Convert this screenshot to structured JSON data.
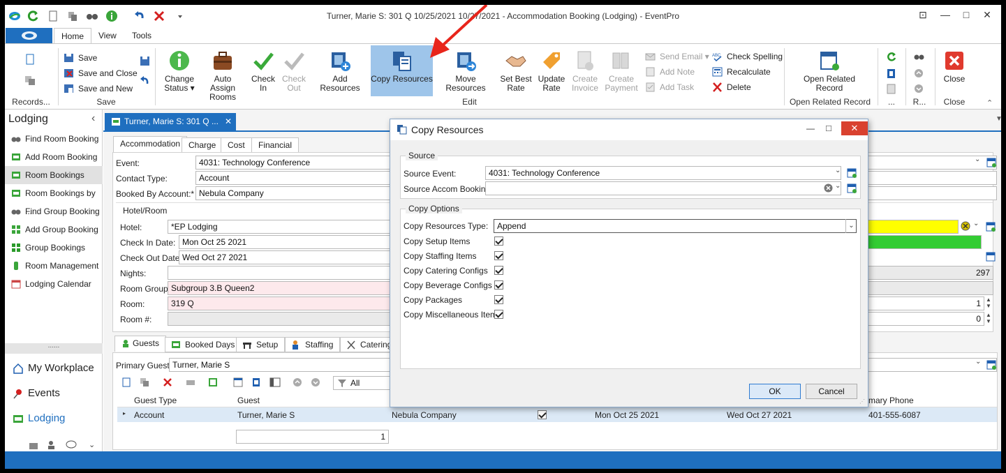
{
  "window": {
    "title": "Turner, Marie S: 301 Q 10/25/2021 10/27/2021  - Accommodation Booking (Lodging) - EventPro"
  },
  "ribbon_tabs": [
    "Home",
    "View",
    "Tools"
  ],
  "ribbon": {
    "records_group": "Records...",
    "save": {
      "save": "Save",
      "save_close": "Save and Close",
      "save_new": "Save and New",
      "group": "Save"
    },
    "edit": {
      "change_status": "Change Status",
      "auto_assign": "Auto Assign Rooms",
      "check_in": "Check In",
      "check_out": "Check Out",
      "add_resources": "Add Resources",
      "copy_resources": "Copy Resources",
      "move_resources": "Move Resources",
      "set_best_rate": "Set Best Rate",
      "update_rate": "Update Rate",
      "create_invoice": "Create Invoice",
      "create_payment": "Create Payment",
      "send_email": "Send Email",
      "add_note": "Add Note",
      "add_task": "Add Task",
      "check_spelling": "Check Spelling",
      "recalculate": "Recalculate",
      "delete": "Delete",
      "group": "Edit"
    },
    "open_related": {
      "button": "Open Related Record",
      "group": "Open Related Record"
    },
    "misc_group1": "...",
    "misc_group2": "R...",
    "close": {
      "button": "Close",
      "group": "Close"
    }
  },
  "sidebar": {
    "title": "Lodging",
    "items": [
      {
        "label": "Find Room Booking",
        "icon": "binoculars-icon"
      },
      {
        "label": "Add Room Booking",
        "icon": "bed-add-icon"
      },
      {
        "label": "Room Bookings",
        "icon": "bed-icon"
      },
      {
        "label": "Room Bookings by ...",
        "icon": "bed-icon"
      },
      {
        "label": "Find Group Booking",
        "icon": "binoculars-icon"
      },
      {
        "label": "Add Group Booking",
        "icon": "group-add-icon"
      },
      {
        "label": "Group Bookings",
        "icon": "group-icon"
      },
      {
        "label": "Room Management",
        "icon": "key-icon"
      },
      {
        "label": "Lodging Calendar",
        "icon": "calendar-icon"
      }
    ],
    "splitter": "......",
    "nav": [
      {
        "label": "My Workplace"
      },
      {
        "label": "Events"
      },
      {
        "label": "Lodging"
      }
    ]
  },
  "doc_tab": "Turner, Marie S: 301 Q ...",
  "form": {
    "tabs": [
      "Accommodation",
      "Charge",
      "Cost",
      "Financial"
    ],
    "event_label": "Event:",
    "event_value": "4031: Technology Conference",
    "contact_type_label": "Contact Type:",
    "contact_type_value": "Account",
    "booked_by_label": "Booked By Account:*",
    "booked_by_value": "Nebula Company",
    "hotel_room_label": "Hotel/Room",
    "hotel_label": "Hotel:",
    "hotel_value": "*EP Lodging",
    "checkin_label": "Check In Date:",
    "checkin_value": "Mon Oct 25 2021",
    "checkout_label": "Check Out Date:",
    "checkout_value": "Wed Oct 27 2021",
    "nights_label": "Nights:",
    "nights_value": "",
    "room_group_label": "Room Group:",
    "room_group_value": "Subgroup 3.B Queen2",
    "room_label": "Room:",
    "room_value": "319 Q",
    "room_num_label": "Room #:",
    "room_num_value": "",
    "right_297": "297",
    "right_1": "1",
    "right_0": "0"
  },
  "lower": {
    "tabs": [
      "Guests",
      "Booked Days",
      "Setup",
      "Staffing",
      "Catering"
    ],
    "primary_guest_label": "Primary Guest:",
    "primary_guest_value": "Turner, Marie S",
    "filter_value": "All",
    "columns": [
      "Guest Type",
      "Guest",
      "",
      "",
      "",
      "",
      "mary Phone"
    ],
    "rows": [
      {
        "guest_type": "Account",
        "guest": "Turner, Marie S",
        "company": "Nebula Company",
        "checkin": "Mon Oct 25 2021",
        "checkout": "Wed Oct 27 2021",
        "phone": "401-555-6087"
      }
    ],
    "footer_count": "1"
  },
  "dialog": {
    "title": "Copy Resources",
    "source_group": "Source",
    "source_event_label": "Source Event:",
    "source_event_value": "4031: Technology Conference",
    "source_accom_label": "Source Accom Booking:",
    "source_accom_value": "",
    "options_group": "Copy Options",
    "type_label": "Copy Resources Type:",
    "type_value": "Append",
    "options": [
      "Copy Setup Items",
      "Copy Staffing Items",
      "Copy Catering Configs",
      "Copy Beverage Configs",
      "Copy Packages",
      "Copy Miscellaneous Items"
    ],
    "ok": "OK",
    "cancel": "Cancel"
  },
  "colors": {
    "accent": "#1f6fbf",
    "highlight": "#9ec5ea",
    "yellow": "#ffff00",
    "green": "#33cc33",
    "arrow": "#e8251b"
  }
}
